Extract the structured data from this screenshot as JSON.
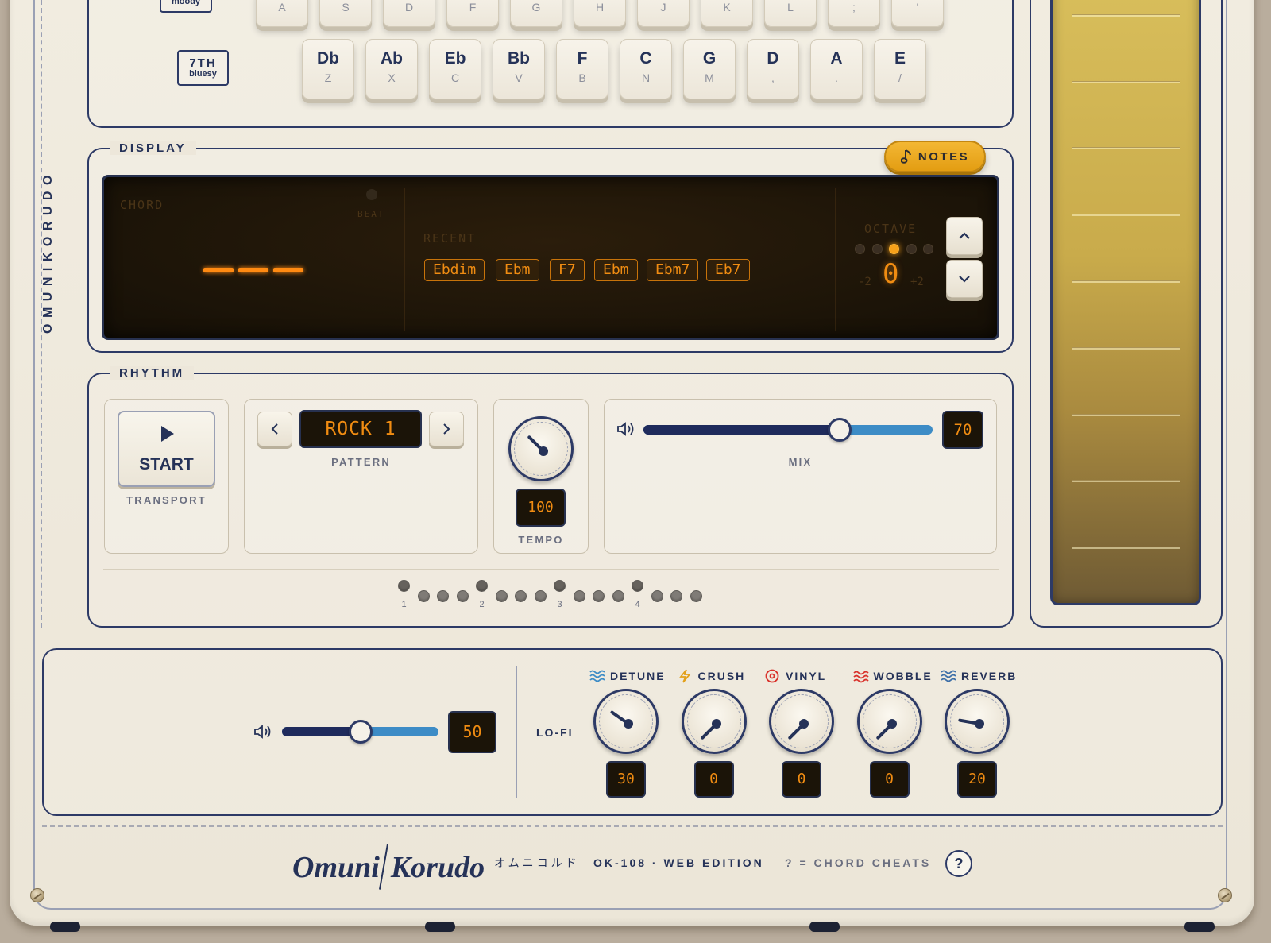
{
  "brand": {
    "vertical": "OMUNIKORUDO",
    "logo_left": "Omuni",
    "logo_right": "Korudo",
    "kana": "オムニコルド",
    "model": "OK-108 · WEB EDITION",
    "cheats_hint": "? = CHORD CHEATS",
    "help_label": "?"
  },
  "keyboard": {
    "mode_buttons": [
      {
        "label": "moody"
      },
      {
        "label": "7TH",
        "sub": "bluesy"
      }
    ],
    "top_row": [
      "A",
      "S",
      "D",
      "F",
      "G",
      "H",
      "J",
      "K",
      "L",
      ";",
      "'"
    ],
    "chord_keys": [
      {
        "note": "Db",
        "shortcut": "Z"
      },
      {
        "note": "Ab",
        "shortcut": "X"
      },
      {
        "note": "Eb",
        "shortcut": "C"
      },
      {
        "note": "Bb",
        "shortcut": "V"
      },
      {
        "note": "F",
        "shortcut": "B"
      },
      {
        "note": "C",
        "shortcut": "N"
      },
      {
        "note": "G",
        "shortcut": "M"
      },
      {
        "note": "D",
        "shortcut": ","
      },
      {
        "note": "A",
        "shortcut": "."
      },
      {
        "note": "E",
        "shortcut": "/"
      }
    ]
  },
  "display": {
    "title": "DISPLAY",
    "notes_button": "NOTES",
    "chord_label": "CHORD",
    "beat_label": "BEAT",
    "recent_label": "RECENT",
    "recent": [
      "Ebdim",
      "Ebm",
      "F7",
      "Ebm",
      "Ebm7",
      "Eb7"
    ],
    "octave_label": "OCTAVE",
    "octave_value": "0",
    "octave_min": "-2",
    "octave_max": "+2",
    "octave_index": 2
  },
  "rhythm": {
    "title": "RHYTHM",
    "start_label": "START",
    "transport_label": "TRANSPORT",
    "pattern_value": "ROCK 1",
    "pattern_label": "PATTERN",
    "tempo_value": "100",
    "tempo_label": "TEMPO",
    "mix_value": "70",
    "mix_label": "MIX",
    "step_numbers": [
      "1",
      "2",
      "3",
      "4"
    ]
  },
  "master": {
    "volume_value": "50"
  },
  "lofi": {
    "label": "LO-FI",
    "effects": [
      {
        "name": "DETUNE",
        "value": "30",
        "color": "#3d8cc6"
      },
      {
        "name": "CRUSH",
        "value": "0",
        "color": "#e3a11a"
      },
      {
        "name": "VINYL",
        "value": "0",
        "color": "#d9322b"
      },
      {
        "name": "WOBBLE",
        "value": "0",
        "color": "#d9322b"
      },
      {
        "name": "REVERB",
        "value": "20",
        "color": "#3d6fa8"
      }
    ]
  },
  "colors": {
    "accent": "#e3a11a",
    "ink": "#253258",
    "lcd_amber": "#f08c12"
  }
}
